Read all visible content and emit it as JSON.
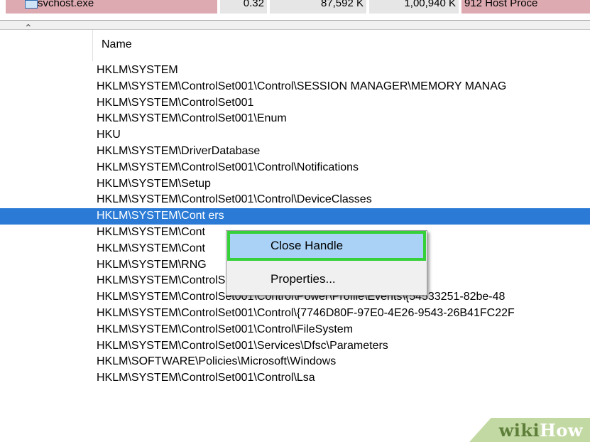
{
  "process_row": {
    "name": "svchost.exe",
    "cpu": "0.32",
    "private_bytes": "87,592 K",
    "working_set": "1,00,940 K",
    "pid_desc": "912 Host Proce"
  },
  "handles": {
    "column_header": "Name",
    "rows": [
      "HKLM\\SYSTEM",
      "HKLM\\SYSTEM\\ControlSet001\\Control\\SESSION MANAGER\\MEMORY MANAG",
      "HKLM\\SYSTEM\\ControlSet001",
      "HKLM\\SYSTEM\\ControlSet001\\Enum",
      "HKU",
      "HKLM\\SYSTEM\\DriverDatabase",
      "HKLM\\SYSTEM\\ControlSet001\\Control\\Notifications",
      "HKLM\\SYSTEM\\Setup",
      "HKLM\\SYSTEM\\ControlSet001\\Control\\DeviceClasses",
      "HKLM\\SYSTEM\\Cont                                                             ers",
      "HKLM\\SYSTEM\\Cont",
      "HKLM\\SYSTEM\\Cont",
      "HKLM\\SYSTEM\\RNG",
      "HKLM\\SYSTEM\\ControlSet001\\Control\\WMI\\Security",
      "HKLM\\SYSTEM\\ControlSet001\\Control\\Power\\Profile\\Events\\{54533251-82be-48",
      "HKLM\\SYSTEM\\ControlSet001\\Control\\{7746D80F-97E0-4E26-9543-26B41FC22F",
      "HKLM\\SYSTEM\\ControlSet001\\Control\\FileSystem",
      "HKLM\\SYSTEM\\ControlSet001\\Services\\Dfsc\\Parameters",
      "HKLM\\SOFTWARE\\Policies\\Microsoft\\Windows",
      "HKLM\\SYSTEM\\ControlSet001\\Control\\Lsa"
    ],
    "selected_index": 9
  },
  "context_menu": {
    "close_handle": "Close Handle",
    "properties": "Properties..."
  },
  "watermark": {
    "part1": "wiki",
    "part2": "How"
  },
  "colors": {
    "selection": "#2b7bd6",
    "menu_highlight": "#a9d2f6",
    "menu_outline": "#36d03a",
    "process_row": "#dcaab0"
  }
}
